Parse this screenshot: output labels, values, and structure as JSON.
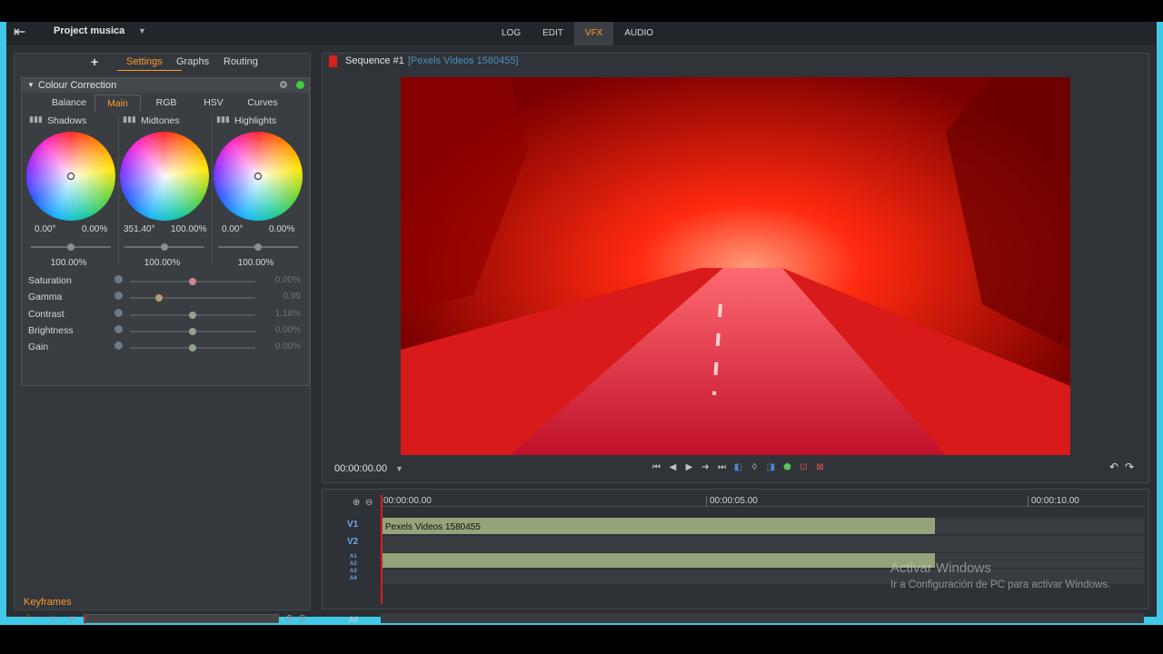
{
  "header": {
    "project_title": "Project musica",
    "modes": [
      "LOG",
      "EDIT",
      "VFX",
      "AUDIO"
    ],
    "active_mode": "VFX"
  },
  "left_panel": {
    "tabs": [
      "Settings",
      "Graphs",
      "Routing"
    ],
    "active_tab": "Settings",
    "effect_title": "Colour Correction",
    "subtabs": [
      "Balance",
      "Main",
      "RGB",
      "HSV",
      "Curves"
    ],
    "active_subtab": "Main",
    "wheels": [
      {
        "label": "Shadows",
        "angle": "0.00°",
        "amount": "0.00%",
        "level": "100.00%"
      },
      {
        "label": "Midtones",
        "angle": "351.40°",
        "amount": "100.00%",
        "level": "100.00%"
      },
      {
        "label": "Highlights",
        "angle": "0.00°",
        "amount": "0.00%",
        "level": "100.00%"
      }
    ],
    "params": [
      {
        "name": "Saturation",
        "value": "0.00%",
        "level": 0.5
      },
      {
        "name": "Gamma",
        "value": "0.99",
        "level": 0.23
      },
      {
        "name": "Contrast",
        "value": "1.18%",
        "level": 0.5
      },
      {
        "name": "Brightness",
        "value": "0.00%",
        "level": 0.5
      },
      {
        "name": "Gain",
        "value": "0.00%",
        "level": 0.5
      }
    ],
    "keyframes_label": "Keyframes"
  },
  "preview": {
    "sequence_title": "Sequence #1",
    "clip_title": "[Pexels Videos 1580455]",
    "timecode": "00:00:00.00"
  },
  "timeline": {
    "ruler_labels": [
      "00:00:00.00",
      "00:00:05.00",
      "00:00:10.00"
    ],
    "tracks": [
      "V1",
      "V2"
    ],
    "audio_tracks": [
      "A1",
      "A2",
      "A3",
      "A4"
    ],
    "clip_label": "Pexels Videos 1580455",
    "all_label": "All"
  },
  "watermark": {
    "line1": "Activar Windows",
    "line2": "Ir a Configuración de PC para activar Windows."
  },
  "colors": {
    "accent": "#ff9a2e",
    "frame": "#40c8e8",
    "clip": "#94a37a",
    "playhead": "#d81e1e"
  }
}
